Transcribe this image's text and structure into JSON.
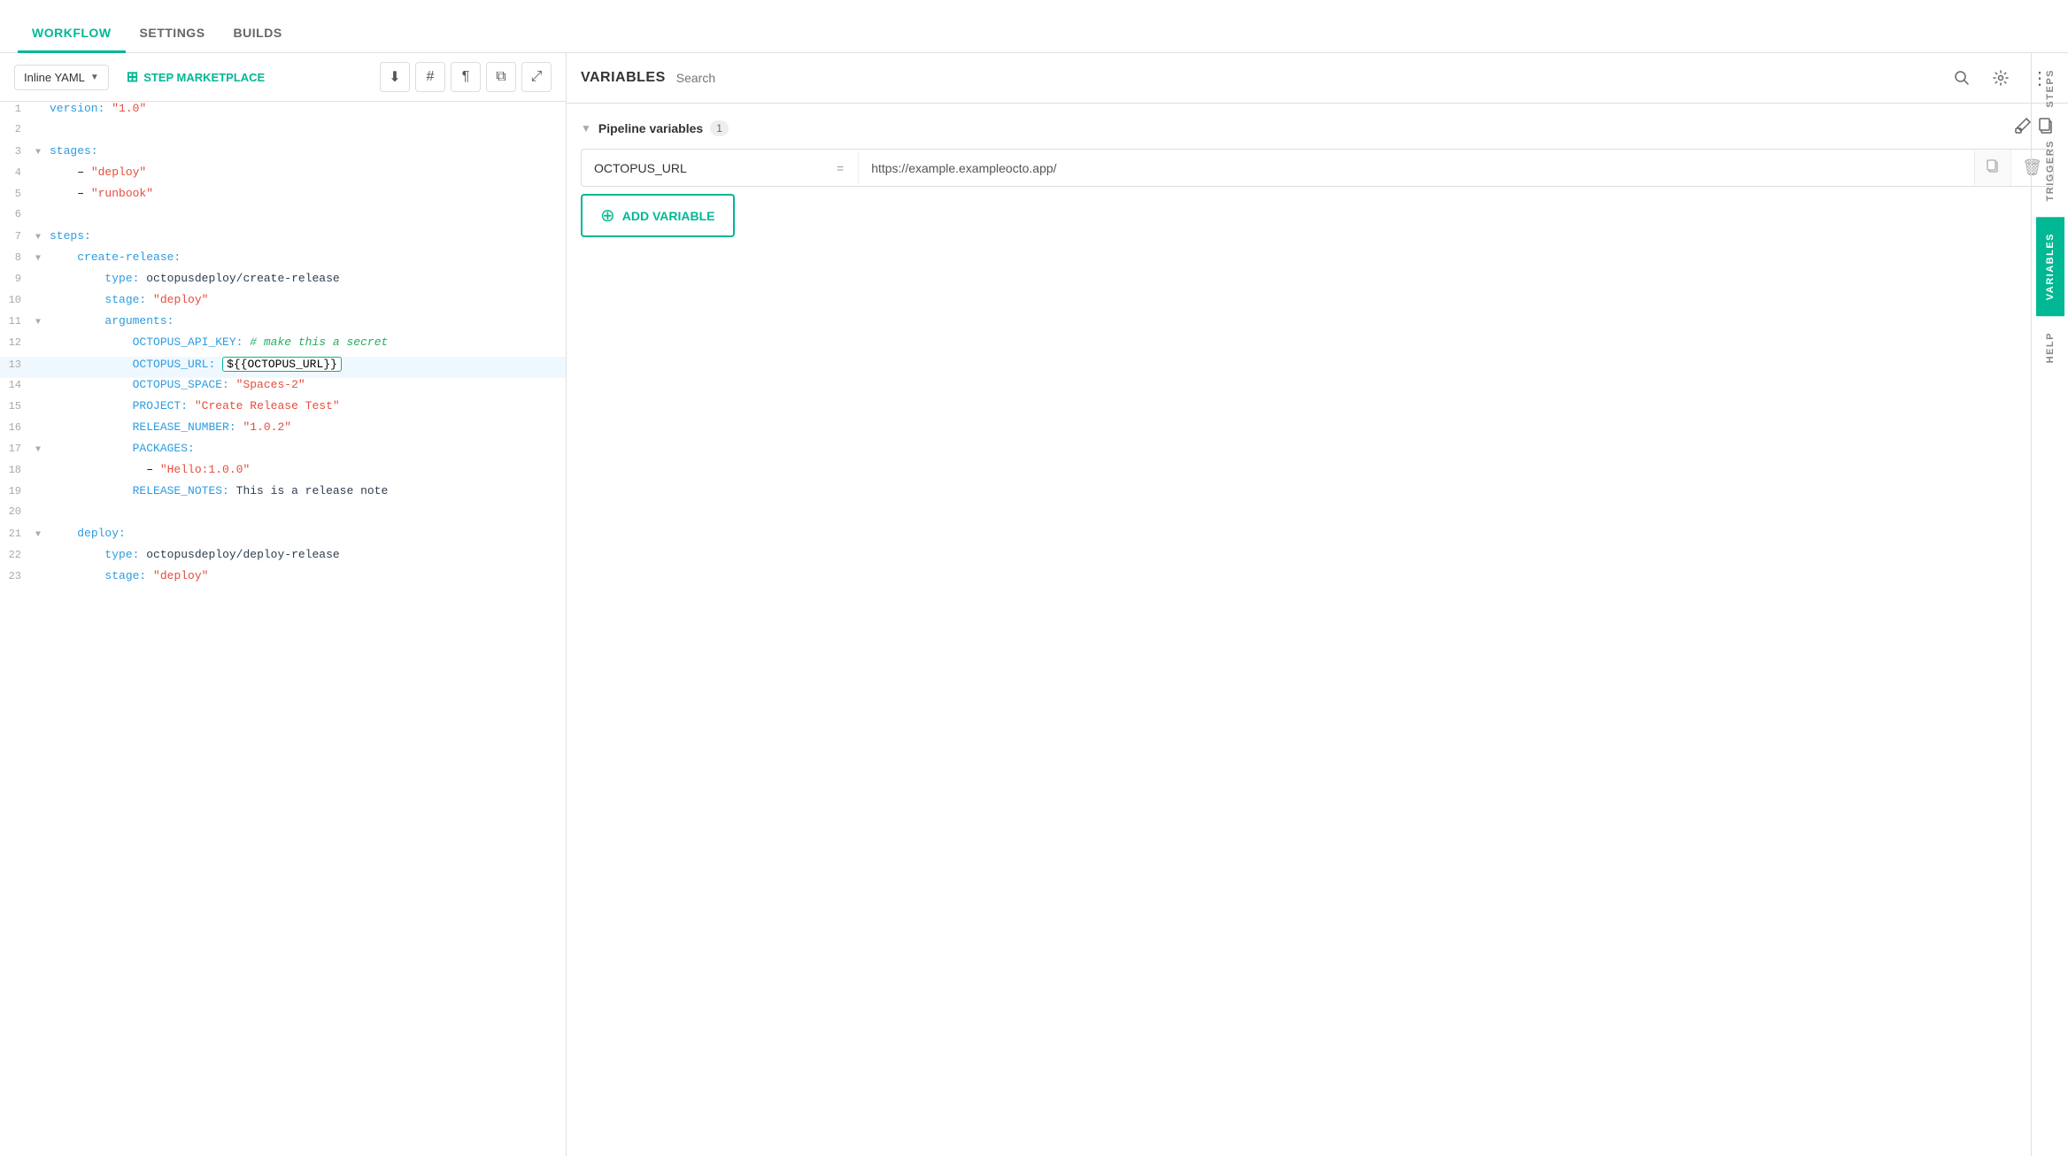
{
  "tabs": {
    "items": [
      {
        "id": "workflow",
        "label": "WORKFLOW",
        "active": true
      },
      {
        "id": "settings",
        "label": "SETTINGS",
        "active": false
      },
      {
        "id": "builds",
        "label": "BUILDS",
        "active": false
      }
    ]
  },
  "editor": {
    "mode_label": "Inline YAML",
    "step_marketplace_label": "STEP MARKETPLACE",
    "lines": [
      {
        "num": 1,
        "arrow": "",
        "indent": 0,
        "content": "version: \"1.0\"",
        "highlight": false
      },
      {
        "num": 2,
        "arrow": "",
        "indent": 0,
        "content": "",
        "highlight": false
      },
      {
        "num": 3,
        "arrow": "▼",
        "indent": 0,
        "content": "stages:",
        "highlight": false
      },
      {
        "num": 4,
        "arrow": "",
        "indent": 1,
        "content": "  - \"deploy\"",
        "highlight": false
      },
      {
        "num": 5,
        "arrow": "",
        "indent": 1,
        "content": "  - \"runbook\"",
        "highlight": false
      },
      {
        "num": 6,
        "arrow": "",
        "indent": 0,
        "content": "",
        "highlight": false
      },
      {
        "num": 7,
        "arrow": "▼",
        "indent": 0,
        "content": "steps:",
        "highlight": false
      },
      {
        "num": 8,
        "arrow": "▼",
        "indent": 1,
        "content": "  create-release:",
        "highlight": false
      },
      {
        "num": 9,
        "arrow": "",
        "indent": 2,
        "content": "    type: octopusdeploy/create-release",
        "highlight": false
      },
      {
        "num": 10,
        "arrow": "",
        "indent": 2,
        "content": "    stage: \"deploy\"",
        "highlight": false
      },
      {
        "num": 11,
        "arrow": "▼",
        "indent": 2,
        "content": "    arguments:",
        "highlight": false
      },
      {
        "num": 12,
        "arrow": "",
        "indent": 3,
        "content": "      OCTOPUS_API_KEY: # make this a secret",
        "highlight": false
      },
      {
        "num": 13,
        "arrow": "",
        "indent": 3,
        "content": "      OCTOPUS_URL:",
        "highlight": true,
        "has_var_tag": true,
        "var_tag": "${{OCTOPUS_URL}}"
      },
      {
        "num": 14,
        "arrow": "",
        "indent": 3,
        "content": "      OCTOPUS_SPACE: \"Spaces-2\"",
        "highlight": false
      },
      {
        "num": 15,
        "arrow": "",
        "indent": 3,
        "content": "      PROJECT: \"Create Release Test\"",
        "highlight": false
      },
      {
        "num": 16,
        "arrow": "",
        "indent": 3,
        "content": "      RELEASE_NUMBER: \"1.0.2\"",
        "highlight": false
      },
      {
        "num": 17,
        "arrow": "▼",
        "indent": 3,
        "content": "      PACKAGES:",
        "highlight": false
      },
      {
        "num": 18,
        "arrow": "",
        "indent": 4,
        "content": "        - \"Hello:1.0.0\"",
        "highlight": false
      },
      {
        "num": 19,
        "arrow": "",
        "indent": 3,
        "content": "      RELEASE_NOTES: This is a release note",
        "highlight": false
      },
      {
        "num": 20,
        "arrow": "",
        "indent": 0,
        "content": "",
        "highlight": false
      },
      {
        "num": 21,
        "arrow": "▼",
        "indent": 1,
        "content": "  deploy:",
        "highlight": false
      },
      {
        "num": 22,
        "arrow": "",
        "indent": 2,
        "content": "    type: octopusdeploy/deploy-release",
        "highlight": false
      },
      {
        "num": 23,
        "arrow": "",
        "indent": 2,
        "content": "    stage: \"deploy\"",
        "highlight": false
      }
    ]
  },
  "variables_panel": {
    "title": "VARIABLES",
    "search_placeholder": "Search",
    "pipeline_section": {
      "title": "Pipeline variables",
      "count": "1",
      "variables": [
        {
          "name": "OCTOPUS_URL",
          "operator": "=",
          "value": "https://example.exampleocto.app/"
        }
      ]
    },
    "add_variable_label": "ADD VARIABLE"
  },
  "sidebar_tabs": [
    {
      "id": "steps",
      "label": "STEPS",
      "active": false
    },
    {
      "id": "triggers",
      "label": "TRIGGERS",
      "active": false
    },
    {
      "id": "variables",
      "label": "VARIABLES",
      "active": true
    },
    {
      "id": "help",
      "label": "HELP",
      "active": false
    }
  ],
  "colors": {
    "accent": "#00b894",
    "tab_active": "#00b894"
  }
}
